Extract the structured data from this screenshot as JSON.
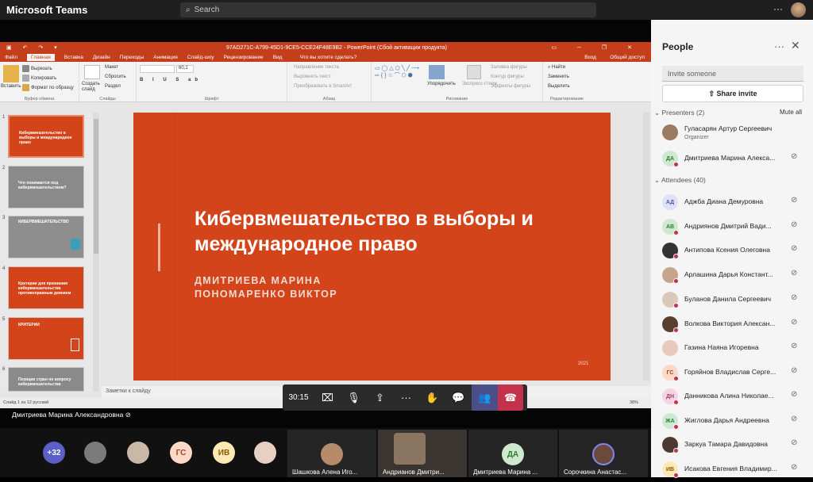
{
  "topbar": {
    "app_title": "Microsoft Teams",
    "search_placeholder": "Search",
    "more": "···"
  },
  "ppt": {
    "window_title": "97AD271C-A799-45D1-9CE5-CCE24F48E9B2 - PowerPoint (Сбой активации продукта)",
    "tabs": [
      "Файл",
      "Главная",
      "Вставка",
      "Дизайн",
      "Переходы",
      "Анимация",
      "Слайд-шоу",
      "Рецензирование",
      "Вид"
    ],
    "tell_me": "Что вы хотите сделать?",
    "login": "Вход",
    "share": "Общий доступ",
    "ribbon": {
      "paste": "Вставить",
      "cut": "Вырезать",
      "copy": "Копировать",
      "format_painter": "Формат по образцу",
      "clipboard": "Буфер обмена",
      "new_slide": "Создать слайд",
      "layout": "Макет",
      "reset": "Сбросить",
      "section": "Раздел",
      "slides": "Слайды",
      "font_size": "60,1",
      "font": "Шрифт",
      "text_direction": "Направление текста",
      "align_text": "Выровнять текст",
      "smartart": "Преобразовать в SmartArt",
      "paragraph": "Абзац",
      "arrange": "Упорядочить",
      "quick_styles": "Экспресс-стили",
      "shape_fill": "Заливка фигуры",
      "shape_outline": "Контур фигуры",
      "shape_effects": "Эффекты фигуры",
      "drawing": "Рисование",
      "find": "Найти",
      "replace": "Заменить",
      "select": "Выделить",
      "editing": "Редактирование"
    },
    "thumbs": [
      {
        "num": "1",
        "text": "Кибервмешательство в выборы и международное право"
      },
      {
        "num": "2",
        "text": "Что понимается под кибервмешательством?"
      },
      {
        "num": "3",
        "text": "КИБЕРВМЕШАТЕЛЬСТВО"
      },
      {
        "num": "4",
        "text": "Критерии для признания кибервмешательства противоправным деянием"
      },
      {
        "num": "5",
        "text": "КРИТЕРИИ"
      },
      {
        "num": "6",
        "text": "Позиции стран по вопросу кибервмешательства"
      }
    ],
    "slide": {
      "title": "Кибервмешательство в выборы и международное право",
      "author1": "ДМИТРИЕВА МАРИНА",
      "author2": "ПОНОМАРЕНКО ВИКТОР",
      "year": "2021"
    },
    "notes": "Заметки к слайду",
    "status": "Слайд 1 из 12     русский",
    "zoom": "38%"
  },
  "call": {
    "time": "30:15"
  },
  "presenter": "Дмитриева Марина Александровна",
  "gallery": {
    "overflow": "+32",
    "initials": [
      "ГС",
      "ИВ",
      "ДА"
    ],
    "tiles": [
      "Шашкова Алена Иго...",
      "Андрианов Дмитри...",
      "Дмитриева Марина ...",
      "Сорочкина Анастас..."
    ]
  },
  "people": {
    "title": "People",
    "invite_placeholder": "Invite someone",
    "share_invite": "Share invite",
    "presenters_label": "Presenters (2)",
    "mute_all": "Mute all",
    "attendees_label": "Attendees (40)",
    "presenters": [
      {
        "name": "Гуласарян Артур Сергеевич",
        "role": "Organizer"
      },
      {
        "name": "Дмитриева Марина Алекса...",
        "initials": "ДА"
      }
    ],
    "attendees": [
      {
        "name": "Аджба Диана Демуровна",
        "initials": "АД"
      },
      {
        "name": "Андриянов Дмитрий Вади...",
        "initials": "АВ"
      },
      {
        "name": "Антипова Ксения Олеговна"
      },
      {
        "name": "Арлашина Дарья Констант..."
      },
      {
        "name": "Буланов Данила Сергеевич"
      },
      {
        "name": "Волкова Виктория Алексан..."
      },
      {
        "name": "Газина Наяна Игоревна"
      },
      {
        "name": "Горяйнов Владислав Серге...",
        "initials": "ГС"
      },
      {
        "name": "Данникова Алина Николае...",
        "initials": "ДН"
      },
      {
        "name": "Жиглова Дарья Андреевна",
        "initials": "ЖА"
      },
      {
        "name": "Заркуа Тамара Давидовна"
      },
      {
        "name": "Исакова Евгения Владимир...",
        "initials": "ИВ"
      }
    ]
  }
}
